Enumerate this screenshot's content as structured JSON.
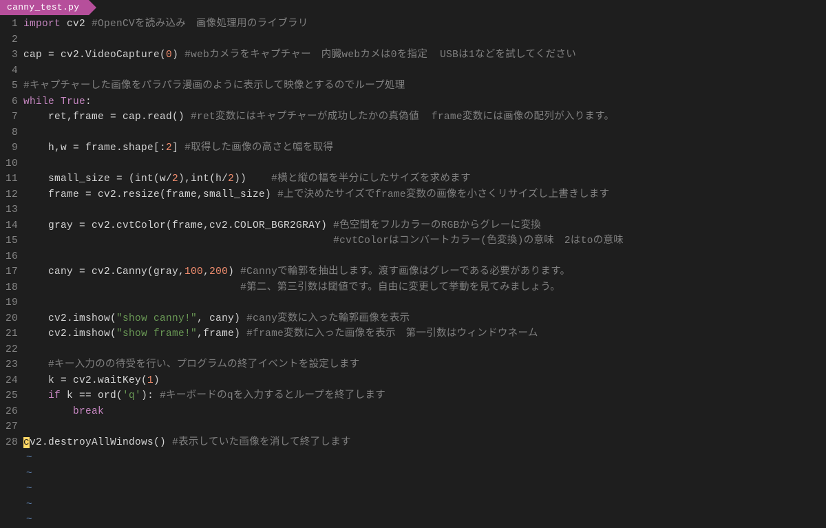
{
  "tab": {
    "filename": "canny_test.py"
  },
  "line_count": 28,
  "tilde_rows": 5,
  "colors": {
    "background": "#1e1e1e",
    "tab_bg": "#b64f9b",
    "keyword": "#c586c0",
    "number": "#f08d6e",
    "string": "#6a9955",
    "comment": "#808080",
    "default": "#d4d4d4",
    "gutter": "#858585",
    "cursor": "#ffd866",
    "tilde": "#5a7ca8"
  },
  "tokens": {
    "l1": [
      [
        "kw",
        "import"
      ],
      [
        "id",
        " cv2 "
      ],
      [
        "cmt",
        "#OpenCVを読み込み　画像処理用のライブラリ"
      ]
    ],
    "l2": [
      [
        "id",
        ""
      ]
    ],
    "l3": [
      [
        "id",
        "cap = cv2.VideoCapture("
      ],
      [
        "num",
        "0"
      ],
      [
        "id",
        ") "
      ],
      [
        "cmt",
        "#webカメラをキャプチャー　内臓webカメは0を指定  USBは1などを試してください"
      ]
    ],
    "l4": [
      [
        "id",
        ""
      ]
    ],
    "l5": [
      [
        "cmt",
        "#キャプチャーした画像をパラパラ漫画のように表示して映像とするのでループ処理"
      ]
    ],
    "l6": [
      [
        "kw",
        "while "
      ],
      [
        "bool",
        "True"
      ],
      [
        "id",
        ":"
      ]
    ],
    "l7": [
      [
        "id",
        "    ret,frame = cap.read() "
      ],
      [
        "cmt",
        "#ret変数にはキャプチャーが成功したかの真偽値  frame変数には画像の配列が入ります。"
      ]
    ],
    "l8": [
      [
        "id",
        ""
      ]
    ],
    "l9": [
      [
        "id",
        "    h,w = frame.shape[:"
      ],
      [
        "num",
        "2"
      ],
      [
        "id",
        "] "
      ],
      [
        "cmt",
        "#取得した画像の高さと幅を取得"
      ]
    ],
    "l10": [
      [
        "id",
        ""
      ]
    ],
    "l11": [
      [
        "id",
        "    small_size = (int(w/"
      ],
      [
        "num",
        "2"
      ],
      [
        "id",
        "),int(h/"
      ],
      [
        "num",
        "2"
      ],
      [
        "id",
        "))    "
      ],
      [
        "cmt",
        "#横と縦の幅を半分にしたサイズを求めます"
      ]
    ],
    "l12": [
      [
        "id",
        "    frame = cv2.resize(frame,small_size) "
      ],
      [
        "cmt",
        "#上で決めたサイズでframe変数の画像を小さくリサイズし上書きします"
      ]
    ],
    "l13": [
      [
        "id",
        ""
      ]
    ],
    "l14": [
      [
        "id",
        "    gray = cv2.cvtColor(frame,cv2.COLOR_BGR2GRAY) "
      ],
      [
        "cmt",
        "#色空間をフルカラーのRGBからグレーに変換"
      ]
    ],
    "l15": [
      [
        "id",
        "                                                  "
      ],
      [
        "cmt",
        "#cvtColorはコンバートカラー(色変換)の意味　2はtoの意味"
      ]
    ],
    "l16": [
      [
        "id",
        ""
      ]
    ],
    "l17": [
      [
        "id",
        "    cany = cv2.Canny(gray,"
      ],
      [
        "num",
        "100"
      ],
      [
        "id",
        ","
      ],
      [
        "num",
        "200"
      ],
      [
        "id",
        ") "
      ],
      [
        "cmt",
        "#Cannyで輪郭を抽出します。渡す画像はグレーである必要があります。"
      ]
    ],
    "l18": [
      [
        "id",
        "                                   "
      ],
      [
        "cmt",
        "#第二、第三引数は閾値です。自由に変更して挙動を見てみましょう。"
      ]
    ],
    "l19": [
      [
        "id",
        ""
      ]
    ],
    "l20": [
      [
        "id",
        "    cv2.imshow("
      ],
      [
        "str",
        "\"show canny!\""
      ],
      [
        "id",
        ", cany) "
      ],
      [
        "cmt",
        "#cany変数に入った輪郭画像を表示"
      ]
    ],
    "l21": [
      [
        "id",
        "    cv2.imshow("
      ],
      [
        "str",
        "\"show frame!\""
      ],
      [
        "id",
        ",frame) "
      ],
      [
        "cmt",
        "#frame変数に入った画像を表示　第一引数はウィンドウネーム"
      ]
    ],
    "l22": [
      [
        "id",
        ""
      ]
    ],
    "l23": [
      [
        "id",
        "    "
      ],
      [
        "cmt",
        "#キー入力のの待受を行い、プログラムの終了イベントを設定します"
      ]
    ],
    "l24": [
      [
        "id",
        "    k = cv2.waitKey("
      ],
      [
        "num",
        "1"
      ],
      [
        "id",
        ")"
      ]
    ],
    "l25": [
      [
        "id",
        "    "
      ],
      [
        "kw",
        "if"
      ],
      [
        "id",
        " k == ord("
      ],
      [
        "str",
        "'q'"
      ],
      [
        "id",
        "): "
      ],
      [
        "cmt",
        "#キーボードのqを入力するとループを終了します"
      ]
    ],
    "l26": [
      [
        "id",
        "        "
      ],
      [
        "kw",
        "break"
      ]
    ],
    "l27": [
      [
        "id",
        ""
      ]
    ],
    "l28": [
      [
        "cursor",
        "c"
      ],
      [
        "id",
        "v2.destroyAllWindows() "
      ],
      [
        "cmt",
        "#表示していた画像を消して終了します"
      ]
    ]
  }
}
